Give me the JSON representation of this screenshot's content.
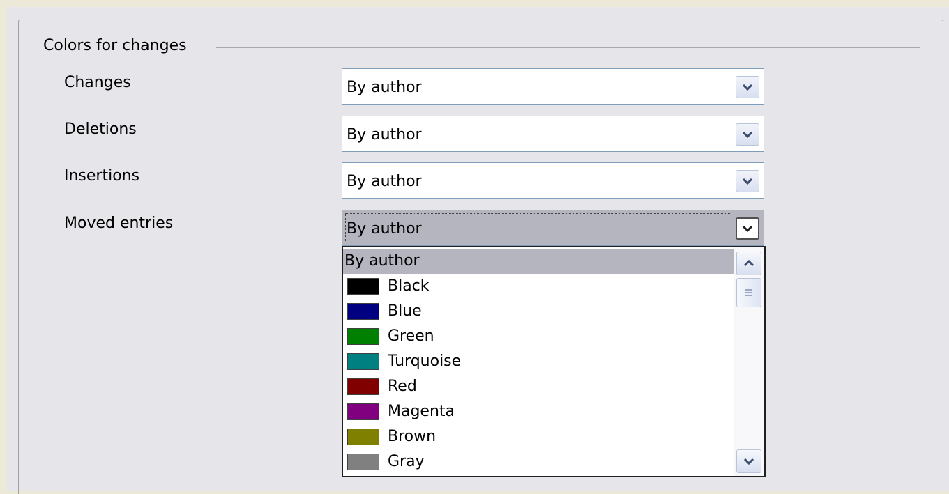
{
  "section": {
    "title": "Colors for changes"
  },
  "rows": [
    {
      "label": "Changes",
      "value": "By author"
    },
    {
      "label": "Deletions",
      "value": "By author"
    },
    {
      "label": "Insertions",
      "value": "By author"
    },
    {
      "label": "Moved entries",
      "value": "By author"
    }
  ],
  "dropdown_list": {
    "selected": "By author",
    "options": [
      {
        "label": "By author",
        "color": null
      },
      {
        "label": "Black",
        "color": "#000000"
      },
      {
        "label": "Blue",
        "color": "#000080"
      },
      {
        "label": "Green",
        "color": "#008000"
      },
      {
        "label": "Turquoise",
        "color": "#008080"
      },
      {
        "label": "Red",
        "color": "#800000"
      },
      {
        "label": "Magenta",
        "color": "#800080"
      },
      {
        "label": "Brown",
        "color": "#808000"
      },
      {
        "label": "Gray",
        "color": "#808080"
      }
    ]
  },
  "icons": {
    "dropdown": "chevron-down-icon",
    "scroll_up": "chevron-up-icon",
    "scroll_down": "chevron-down-icon",
    "scroll_thumb": "grip-icon"
  }
}
